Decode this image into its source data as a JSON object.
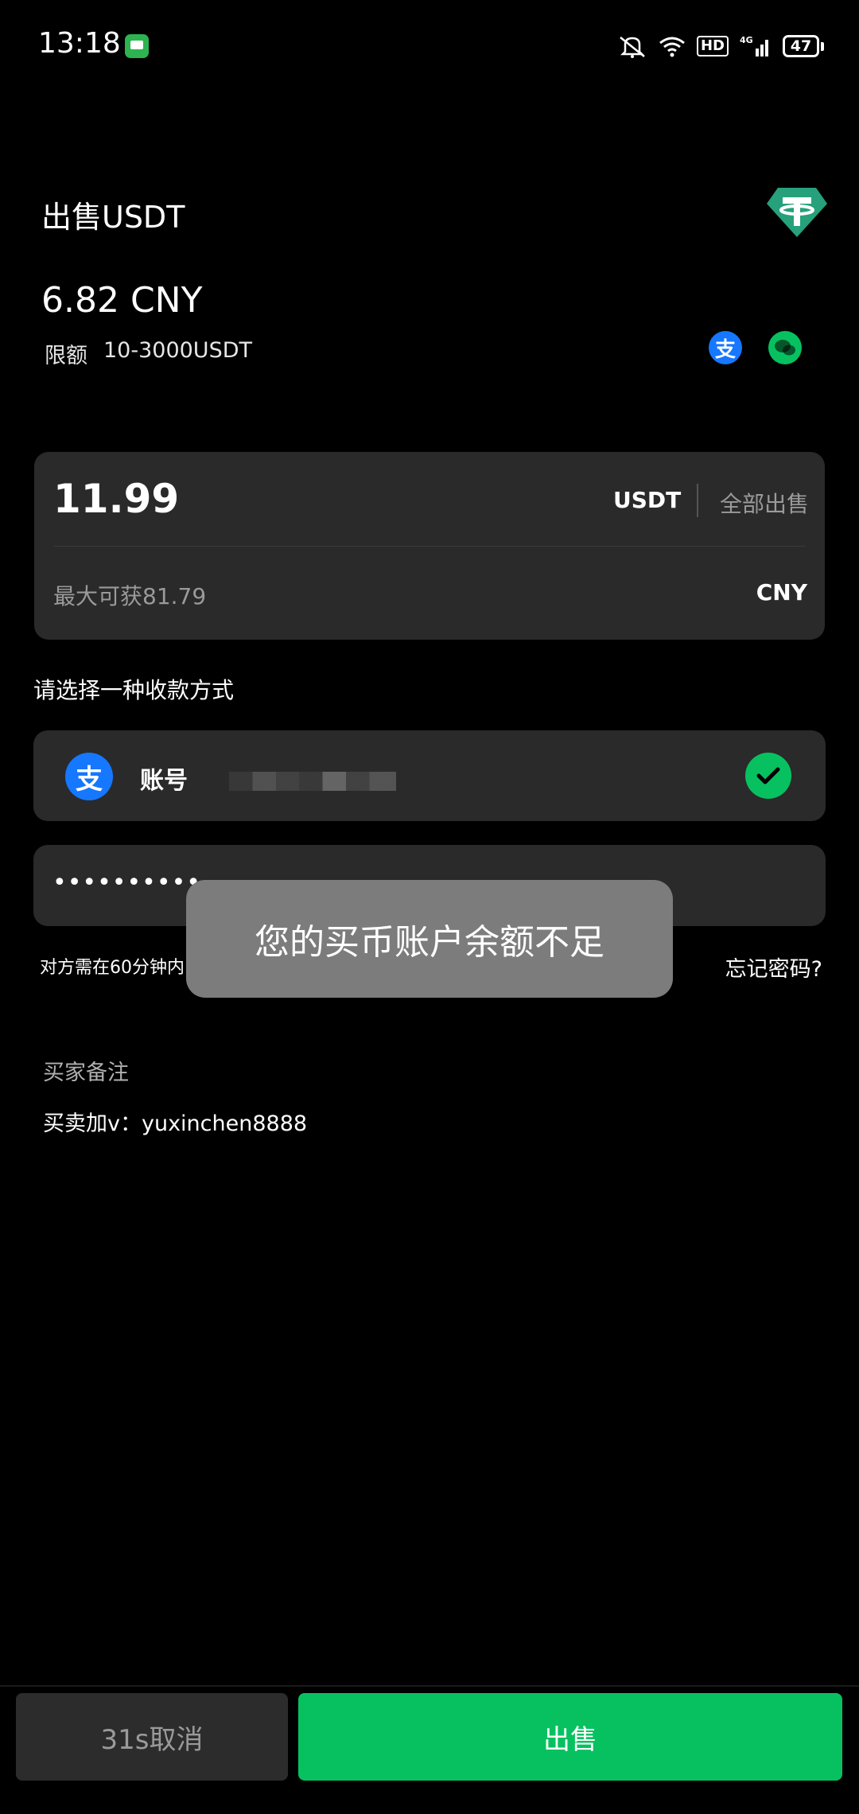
{
  "status_bar": {
    "time": "13:18",
    "hd": "HD",
    "network": "4G",
    "battery": "47"
  },
  "header": {
    "title": "出售USDT",
    "price": "6.82 CNY",
    "limit_label": "限额",
    "limit_value": "10-3000USDT"
  },
  "amount_card": {
    "amount": "11.99",
    "unit": "USDT",
    "sell_all": "全部出售",
    "max_receive": "最大可获81.79",
    "receive_unit": "CNY"
  },
  "payment": {
    "section_label": "请选择一种收款方式",
    "method_label": "账号",
    "alipay_glyph": "支"
  },
  "password": {
    "dots": "••••••••••",
    "hint": "对方需在60分钟内",
    "forgot": "忘记密码?"
  },
  "note": {
    "label": "买家备注",
    "text": "买卖加v：yuxinchen8888"
  },
  "toast": {
    "message": "您的买币账户余额不足"
  },
  "bottom": {
    "cancel": "31s取消",
    "sell": "出售"
  },
  "colors": {
    "accent_green": "#07c160",
    "alipay_blue": "#1677ff",
    "tether_teal": "#26a17b"
  }
}
